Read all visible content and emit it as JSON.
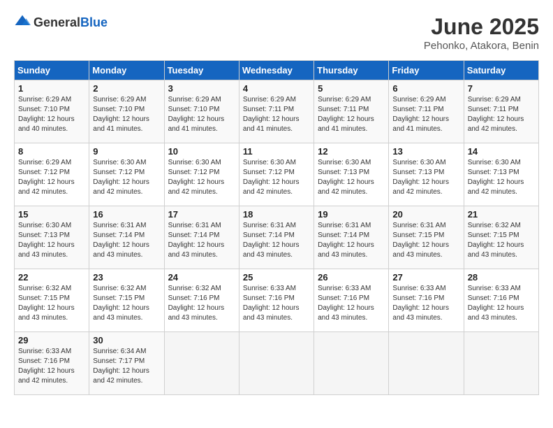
{
  "header": {
    "logo_general": "General",
    "logo_blue": "Blue",
    "month_year": "June 2025",
    "location": "Pehonko, Atakora, Benin"
  },
  "weekdays": [
    "Sunday",
    "Monday",
    "Tuesday",
    "Wednesday",
    "Thursday",
    "Friday",
    "Saturday"
  ],
  "weeks": [
    [
      {
        "day": "1",
        "sunrise": "6:29 AM",
        "sunset": "7:10 PM",
        "daylight": "12 hours and 40 minutes."
      },
      {
        "day": "2",
        "sunrise": "6:29 AM",
        "sunset": "7:10 PM",
        "daylight": "12 hours and 41 minutes."
      },
      {
        "day": "3",
        "sunrise": "6:29 AM",
        "sunset": "7:10 PM",
        "daylight": "12 hours and 41 minutes."
      },
      {
        "day": "4",
        "sunrise": "6:29 AM",
        "sunset": "7:11 PM",
        "daylight": "12 hours and 41 minutes."
      },
      {
        "day": "5",
        "sunrise": "6:29 AM",
        "sunset": "7:11 PM",
        "daylight": "12 hours and 41 minutes."
      },
      {
        "day": "6",
        "sunrise": "6:29 AM",
        "sunset": "7:11 PM",
        "daylight": "12 hours and 41 minutes."
      },
      {
        "day": "7",
        "sunrise": "6:29 AM",
        "sunset": "7:11 PM",
        "daylight": "12 hours and 42 minutes."
      }
    ],
    [
      {
        "day": "8",
        "sunrise": "6:29 AM",
        "sunset": "7:12 PM",
        "daylight": "12 hours and 42 minutes."
      },
      {
        "day": "9",
        "sunrise": "6:30 AM",
        "sunset": "7:12 PM",
        "daylight": "12 hours and 42 minutes."
      },
      {
        "day": "10",
        "sunrise": "6:30 AM",
        "sunset": "7:12 PM",
        "daylight": "12 hours and 42 minutes."
      },
      {
        "day": "11",
        "sunrise": "6:30 AM",
        "sunset": "7:12 PM",
        "daylight": "12 hours and 42 minutes."
      },
      {
        "day": "12",
        "sunrise": "6:30 AM",
        "sunset": "7:13 PM",
        "daylight": "12 hours and 42 minutes."
      },
      {
        "day": "13",
        "sunrise": "6:30 AM",
        "sunset": "7:13 PM",
        "daylight": "12 hours and 42 minutes."
      },
      {
        "day": "14",
        "sunrise": "6:30 AM",
        "sunset": "7:13 PM",
        "daylight": "12 hours and 42 minutes."
      }
    ],
    [
      {
        "day": "15",
        "sunrise": "6:30 AM",
        "sunset": "7:13 PM",
        "daylight": "12 hours and 43 minutes."
      },
      {
        "day": "16",
        "sunrise": "6:31 AM",
        "sunset": "7:14 PM",
        "daylight": "12 hours and 43 minutes."
      },
      {
        "day": "17",
        "sunrise": "6:31 AM",
        "sunset": "7:14 PM",
        "daylight": "12 hours and 43 minutes."
      },
      {
        "day": "18",
        "sunrise": "6:31 AM",
        "sunset": "7:14 PM",
        "daylight": "12 hours and 43 minutes."
      },
      {
        "day": "19",
        "sunrise": "6:31 AM",
        "sunset": "7:14 PM",
        "daylight": "12 hours and 43 minutes."
      },
      {
        "day": "20",
        "sunrise": "6:31 AM",
        "sunset": "7:15 PM",
        "daylight": "12 hours and 43 minutes."
      },
      {
        "day": "21",
        "sunrise": "6:32 AM",
        "sunset": "7:15 PM",
        "daylight": "12 hours and 43 minutes."
      }
    ],
    [
      {
        "day": "22",
        "sunrise": "6:32 AM",
        "sunset": "7:15 PM",
        "daylight": "12 hours and 43 minutes."
      },
      {
        "day": "23",
        "sunrise": "6:32 AM",
        "sunset": "7:15 PM",
        "daylight": "12 hours and 43 minutes."
      },
      {
        "day": "24",
        "sunrise": "6:32 AM",
        "sunset": "7:16 PM",
        "daylight": "12 hours and 43 minutes."
      },
      {
        "day": "25",
        "sunrise": "6:33 AM",
        "sunset": "7:16 PM",
        "daylight": "12 hours and 43 minutes."
      },
      {
        "day": "26",
        "sunrise": "6:33 AM",
        "sunset": "7:16 PM",
        "daylight": "12 hours and 43 minutes."
      },
      {
        "day": "27",
        "sunrise": "6:33 AM",
        "sunset": "7:16 PM",
        "daylight": "12 hours and 43 minutes."
      },
      {
        "day": "28",
        "sunrise": "6:33 AM",
        "sunset": "7:16 PM",
        "daylight": "12 hours and 43 minutes."
      }
    ],
    [
      {
        "day": "29",
        "sunrise": "6:33 AM",
        "sunset": "7:16 PM",
        "daylight": "12 hours and 42 minutes."
      },
      {
        "day": "30",
        "sunrise": "6:34 AM",
        "sunset": "7:17 PM",
        "daylight": "12 hours and 42 minutes."
      },
      null,
      null,
      null,
      null,
      null
    ]
  ],
  "labels": {
    "sunrise": "Sunrise:",
    "sunset": "Sunset:",
    "daylight": "Daylight:"
  }
}
